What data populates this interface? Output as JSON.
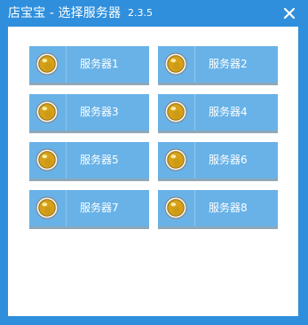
{
  "window": {
    "title": "店宝宝 - 选择服务器",
    "version": "2.3.5"
  },
  "servers": [
    {
      "label": "服务器1"
    },
    {
      "label": "服务器2"
    },
    {
      "label": "服务器3"
    },
    {
      "label": "服务器4"
    },
    {
      "label": "服务器5"
    },
    {
      "label": "服务器6"
    },
    {
      "label": "服务器7"
    },
    {
      "label": "服务器8"
    }
  ],
  "colors": {
    "title_bar": "#2f8fdc",
    "button_fill": "#68b2e8",
    "button_border": "#8ea8b8",
    "status_indicator": "#d6a11a"
  },
  "icons": {
    "close": "close-icon",
    "status": "status-indicator-icon"
  }
}
